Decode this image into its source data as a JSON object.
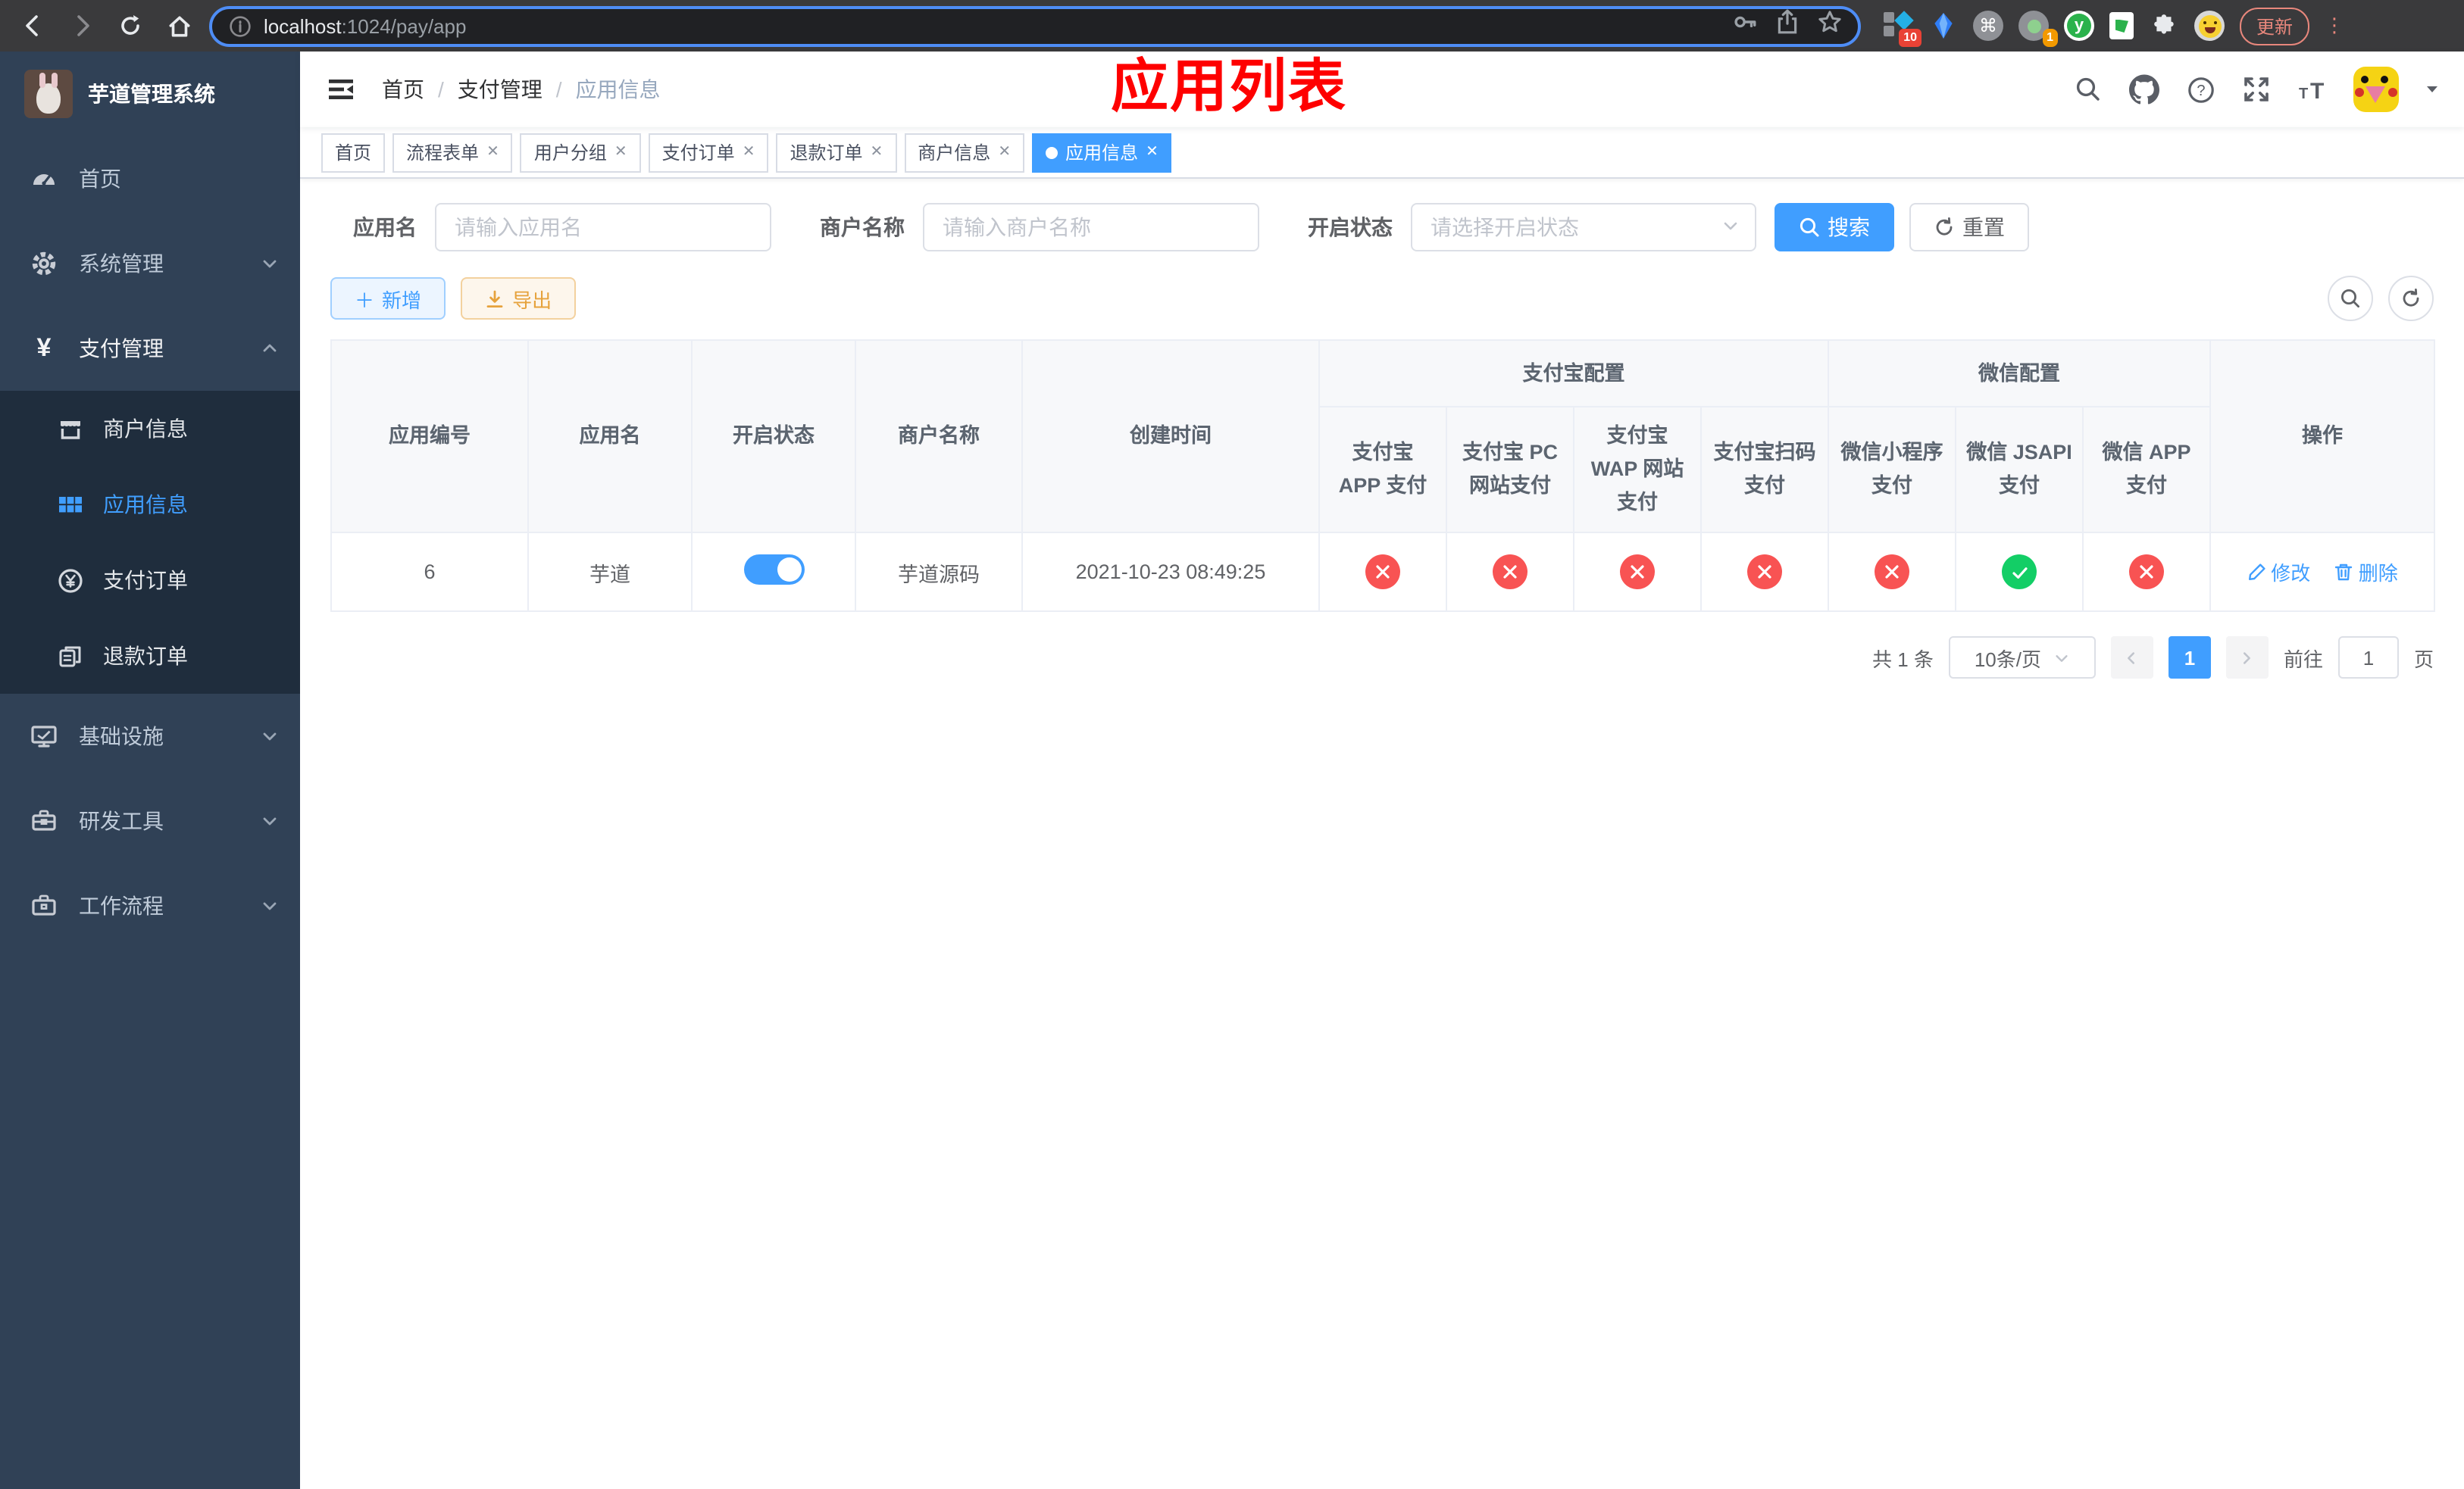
{
  "colors": {
    "accent": "#409eff",
    "success": "#13ce66",
    "danger": "#f85353",
    "warning": "#e6a23c",
    "sidebar_bg": "#304156",
    "submenu_bg": "#1f2d3d",
    "annotation_red": "#fe0000"
  },
  "browser": {
    "url_host": "localhost",
    "url_rest": ":1024/pay/app",
    "update_label": "更新",
    "ext_badge_1": "10",
    "ext_badge_2": "1"
  },
  "sidebar": {
    "title": "芋道管理系统",
    "items": [
      {
        "label": "首页",
        "icon": "dashboard-icon"
      },
      {
        "label": "系统管理",
        "icon": "gear-icon",
        "chevron": "down"
      },
      {
        "label": "支付管理",
        "icon": "yen-icon",
        "chevron": "up"
      },
      {
        "label": "商户信息",
        "icon": "store-icon",
        "sub": true
      },
      {
        "label": "应用信息",
        "icon": "grid-icon",
        "sub": true,
        "active": true
      },
      {
        "label": "支付订单",
        "icon": "pay-order-icon",
        "sub": true
      },
      {
        "label": "退款订单",
        "icon": "refund-icon",
        "sub": true
      },
      {
        "label": "基础设施",
        "icon": "monitor-icon",
        "chevron": "down"
      },
      {
        "label": "研发工具",
        "icon": "toolbox-icon",
        "chevron": "down"
      },
      {
        "label": "工作流程",
        "icon": "briefcase-icon",
        "chevron": "down"
      }
    ]
  },
  "navbar": {
    "breadcrumb": [
      "首页",
      "支付管理",
      "应用信息"
    ],
    "annotation": "应用列表"
  },
  "tags": {
    "items": [
      {
        "label": "首页",
        "closable": false,
        "active": false
      },
      {
        "label": "流程表单",
        "closable": true,
        "active": false
      },
      {
        "label": "用户分组",
        "closable": true,
        "active": false
      },
      {
        "label": "支付订单",
        "closable": true,
        "active": false
      },
      {
        "label": "退款订单",
        "closable": true,
        "active": false
      },
      {
        "label": "商户信息",
        "closable": true,
        "active": false
      },
      {
        "label": "应用信息",
        "closable": true,
        "active": true
      }
    ]
  },
  "filter": {
    "app_name_label": "应用名",
    "app_name_placeholder": "请输入应用名",
    "merchant_label": "商户名称",
    "merchant_placeholder": "请输入商户名称",
    "status_label": "开启状态",
    "status_placeholder": "请选择开启状态",
    "search_label": "搜索",
    "reset_label": "重置"
  },
  "toolbar": {
    "add_label": "新增",
    "export_label": "导出"
  },
  "table": {
    "headers": {
      "id": "应用编号",
      "name": "应用名",
      "status": "开启状态",
      "merchant": "商户名称",
      "created": "创建时间",
      "alipay_group": "支付宝配置",
      "wechat_group": "微信配置",
      "ops": "操作",
      "config_cols": [
        "支付宝 APP 支付",
        "支付宝 PC 网站支付",
        "支付宝 WAP 网站支付",
        "支付宝扫码支付",
        "微信小程序支付",
        "微信 JSAPI 支付",
        "微信 APP 支付"
      ]
    },
    "ops_labels": {
      "edit": "修改",
      "delete": "删除"
    },
    "rows": [
      {
        "id": "6",
        "name": "芋道",
        "enabled": true,
        "merchant": "芋道源码",
        "created": "2021-10-23 08:49:25",
        "configs": [
          false,
          false,
          false,
          false,
          false,
          true,
          false
        ]
      }
    ]
  },
  "pagination": {
    "total_text": "共 1 条",
    "page_size": "10条/页",
    "current_page": "1",
    "goto_label": "前往",
    "goto_value": "1",
    "page_unit": "页"
  }
}
